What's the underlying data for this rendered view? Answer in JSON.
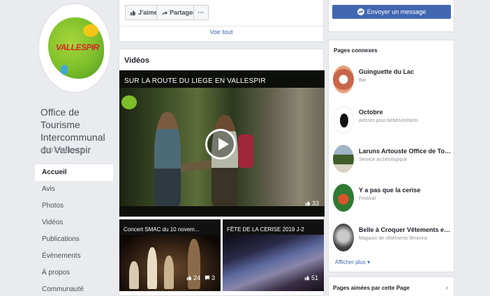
{
  "page": {
    "name": "Office de Tourisme Intercommunal du Vallespir",
    "handle": "@OTIVallespir",
    "logo_text": "VALLESPIR"
  },
  "nav": [
    {
      "label": "Accueil",
      "active": true
    },
    {
      "label": "Avis"
    },
    {
      "label": "Photos"
    },
    {
      "label": "Vidéos"
    },
    {
      "label": "Publications"
    },
    {
      "label": "Évènements"
    },
    {
      "label": "À propos"
    },
    {
      "label": "Communauté"
    }
  ],
  "actions": {
    "like": "J'aime",
    "share": "Partager",
    "more": "···",
    "see_all": "Voir tout"
  },
  "videos": {
    "title": "Vidéos",
    "main": {
      "title": "SUR LA ROUTE DU LIEGE EN VALLESPIR",
      "likes": "33"
    },
    "thumbs": [
      {
        "title": "Concert SMAC du 10 novem...",
        "likes": "24",
        "comments": "3"
      },
      {
        "title": "FÊTE DE LA CERISE 2019 J-2",
        "likes": "51"
      }
    ]
  },
  "message_button": "Envoyer un message",
  "related": {
    "title": "Pages connexes",
    "items": [
      {
        "name": "Guinguette du Lac",
        "category": "Bar"
      },
      {
        "name": "Octobre",
        "category": "Articles pour bébés/enfants"
      },
      {
        "name": "Laruns Artouste Office de Touris...",
        "category": "Service archéologique"
      },
      {
        "name": "Y a pas que la cerise",
        "category": "Festival"
      },
      {
        "name": "Belle à Croquer Vêtements et ac...",
        "category": "Magasin de vêtements féminins"
      }
    ],
    "see_more": "Afficher plus"
  },
  "liked": {
    "title": "Pages aimées par cette Page"
  },
  "colors": {
    "brand_blue": "#4267b2",
    "background": "#e9ebee"
  }
}
